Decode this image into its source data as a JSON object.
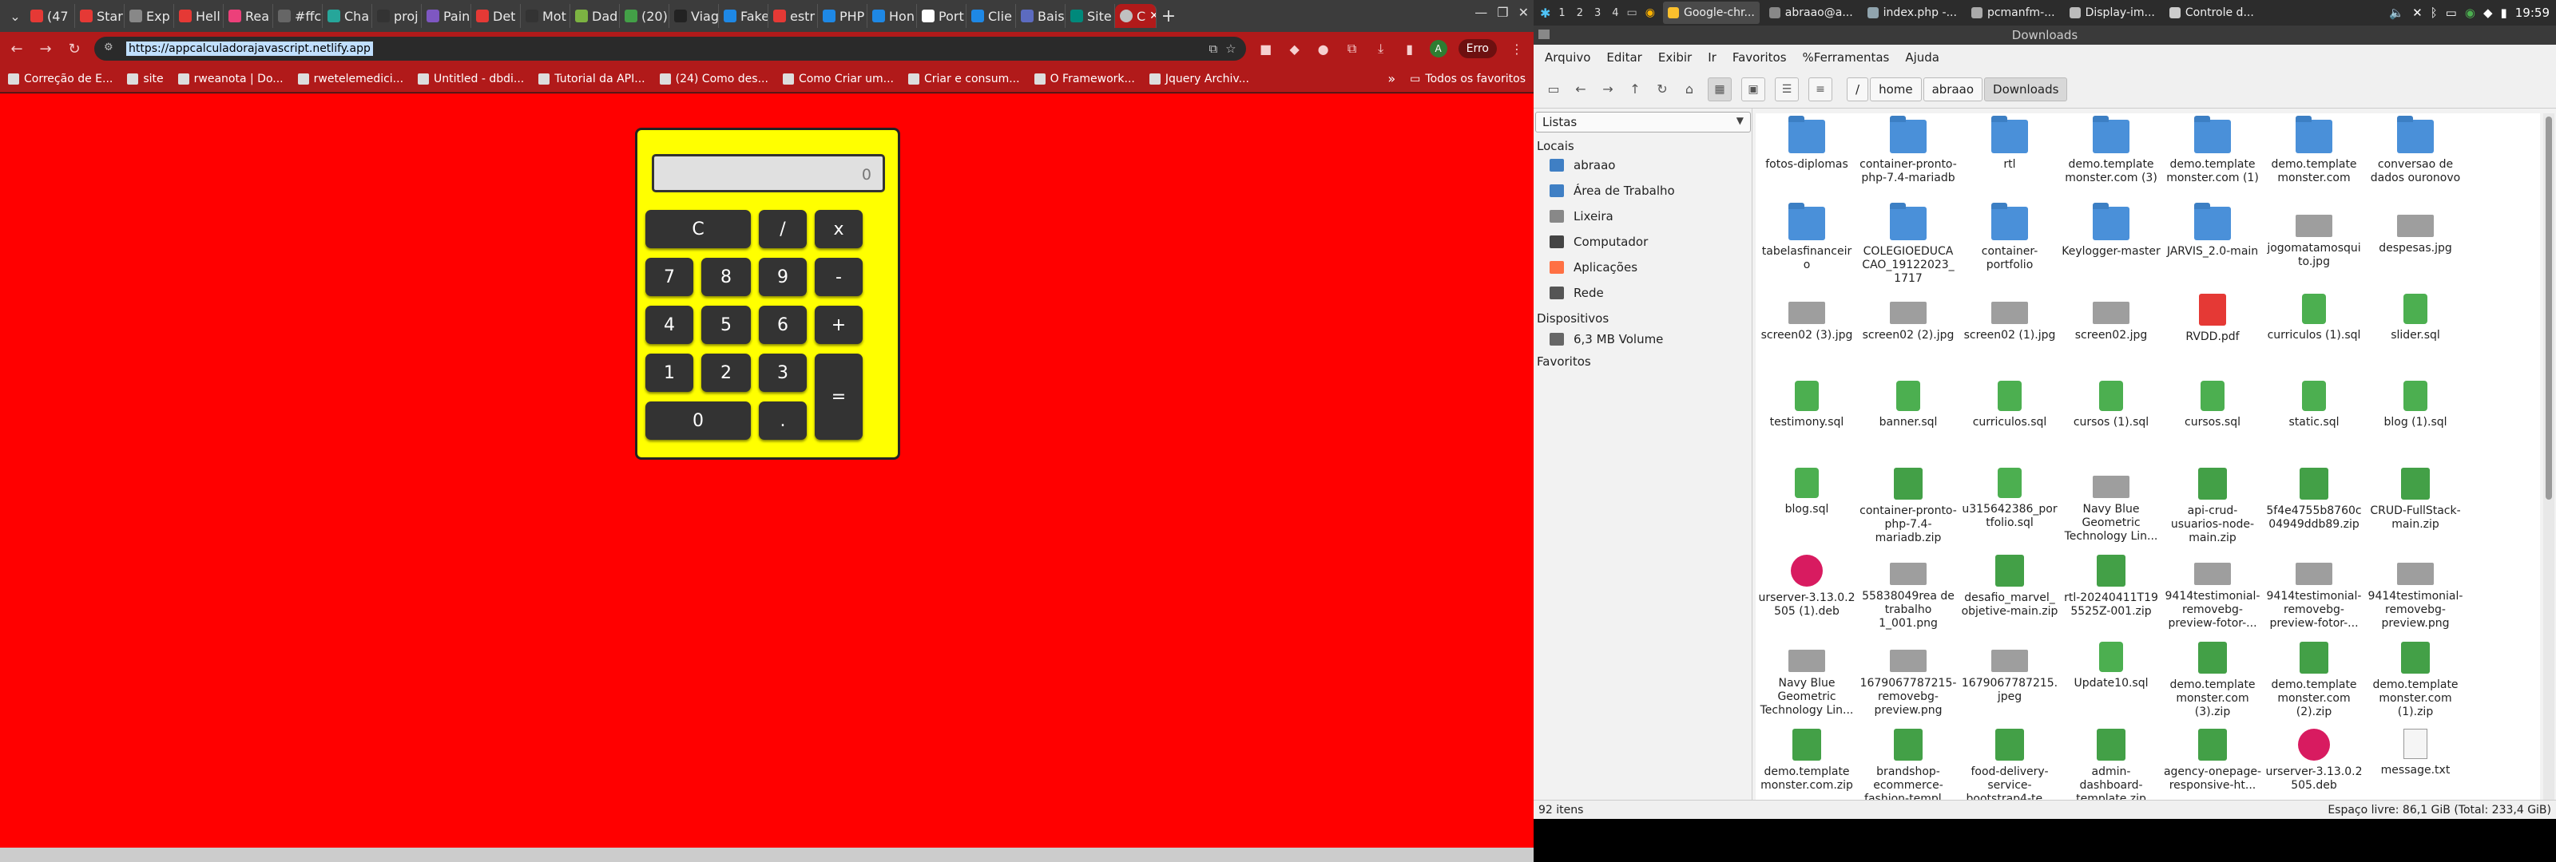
{
  "browser": {
    "tabs": [
      {
        "label": "(47",
        "color": "#e53935"
      },
      {
        "label": "Star",
        "color": "#e53935"
      },
      {
        "label": "Exp",
        "color": "#888"
      },
      {
        "label": "Hell",
        "color": "#e53935"
      },
      {
        "label": "Rea",
        "color": "#ec407a"
      },
      {
        "label": "#ffc",
        "color": "#666"
      },
      {
        "label": "Cha",
        "color": "#26a69a"
      },
      {
        "label": "proj",
        "color": "#333"
      },
      {
        "label": "Pain",
        "color": "#7e57c2"
      },
      {
        "label": "Det",
        "color": "#e53935"
      },
      {
        "label": "Mot",
        "color": "#333"
      },
      {
        "label": "Dad",
        "color": "#7cb342"
      },
      {
        "label": "(20)",
        "color": "#43a047"
      },
      {
        "label": "Viag",
        "color": "#222"
      },
      {
        "label": "Fake",
        "color": "#1e88e5"
      },
      {
        "label": "estr",
        "color": "#e53935"
      },
      {
        "label": "PHP",
        "color": "#1e88e5"
      },
      {
        "label": "Hon",
        "color": "#1e88e5"
      },
      {
        "label": "Port",
        "color": "#fff"
      },
      {
        "label": "Clie",
        "color": "#1e88e5"
      },
      {
        "label": "Bais",
        "color": "#5c6bc0"
      },
      {
        "label": "Site",
        "color": "#00897b"
      }
    ],
    "active_tab_label": "C",
    "url": "https://appcalculadorajavascript.netlify.app",
    "profile_initial": "A",
    "error_label": "Erro",
    "bookmarks": [
      "Correção de E...",
      "site",
      "rweanota | Do...",
      "rwetelemedici...",
      "Untitled - dbdi...",
      "Tutorial da API...",
      "(24) Como des...",
      "Como Criar um...",
      "Criar e consum...",
      "O Framework...",
      "Jquery Archiv..."
    ],
    "bookmarks_more": "»",
    "all_bookmarks": "Todos os favoritos"
  },
  "calculator": {
    "display_value": "0",
    "buttons": {
      "clear": "C",
      "divide": "/",
      "multiply": "x",
      "n7": "7",
      "n8": "8",
      "n9": "9",
      "minus": "-",
      "n4": "4",
      "n5": "5",
      "n6": "6",
      "plus": "+",
      "n1": "1",
      "n2": "2",
      "n3": "3",
      "equals": "=",
      "n0": "0",
      "dot": "."
    }
  },
  "panel": {
    "workspaces": [
      "1",
      "2",
      "3",
      "4"
    ],
    "tasks": [
      "Google-chr...",
      "abraao@a...",
      "index.php -...",
      "pcmanfm-...",
      "Display-im...",
      "Controle d..."
    ],
    "clock": "19:59"
  },
  "filemanager": {
    "title": "Downloads",
    "menu": [
      "Arquivo",
      "Editar",
      "Exibir",
      "Ir",
      "Favoritos",
      "%Ferramentas",
      "Ajuda"
    ],
    "path": [
      "/",
      "home",
      "abraao",
      "Downloads"
    ],
    "side_mode": "Listas",
    "places_header": "Locais",
    "places": [
      "abraao",
      "Área de Trabalho",
      "Lixeira",
      "Computador",
      "Aplicações",
      "Rede"
    ],
    "devices_header": "Dispositivos",
    "devices": [
      "6,3 MB Volume"
    ],
    "favorites_header": "Favoritos",
    "files": [
      {
        "name": "fotos-diplomas",
        "type": "folder"
      },
      {
        "name": "container-pronto-php-7.4-mariadb",
        "type": "folder"
      },
      {
        "name": "rtl",
        "type": "folder"
      },
      {
        "name": "demo.template monster.com (3)",
        "type": "folder"
      },
      {
        "name": "demo.template monster.com (1)",
        "type": "folder"
      },
      {
        "name": "demo.template monster.com",
        "type": "folder"
      },
      {
        "name": "conversao de dados ouronovo",
        "type": "folder"
      },
      {
        "name": "tabelasfinanceir o",
        "type": "folder"
      },
      {
        "name": "COLEGIOEDUCA CAO_19122023_ 1717",
        "type": "folder"
      },
      {
        "name": "container-portfolio",
        "type": "folder"
      },
      {
        "name": "Keylogger-master",
        "type": "folder"
      },
      {
        "name": "JARVIS_2.0-main",
        "type": "folder"
      },
      {
        "name": "jogomatamosqui to.jpg",
        "type": "img"
      },
      {
        "name": "despesas.jpg",
        "type": "img"
      },
      {
        "name": "screen02 (3).jpg",
        "type": "img"
      },
      {
        "name": "screen02 (2).jpg",
        "type": "img"
      },
      {
        "name": "screen02 (1).jpg",
        "type": "img"
      },
      {
        "name": "screen02.jpg",
        "type": "img"
      },
      {
        "name": "RVDD.pdf",
        "type": "pdf"
      },
      {
        "name": "curriculos (1).sql",
        "type": "sql"
      },
      {
        "name": "slider.sql",
        "type": "sql"
      },
      {
        "name": "testimony.sql",
        "type": "sql"
      },
      {
        "name": "banner.sql",
        "type": "sql"
      },
      {
        "name": "curriculos.sql",
        "type": "sql"
      },
      {
        "name": "cursos (1).sql",
        "type": "sql"
      },
      {
        "name": "cursos.sql",
        "type": "sql"
      },
      {
        "name": "static.sql",
        "type": "sql"
      },
      {
        "name": "blog (1).sql",
        "type": "sql"
      },
      {
        "name": "blog.sql",
        "type": "sql"
      },
      {
        "name": "container-pronto-php-7.4-mariadb.zip",
        "type": "zip"
      },
      {
        "name": "u315642386_por tfolio.sql",
        "type": "sql"
      },
      {
        "name": "Navy Blue Geometric Technology Lin...",
        "type": "img"
      },
      {
        "name": "api-crud-usuarios-node-main.zip",
        "type": "zip"
      },
      {
        "name": "5f4e4755b8760c 04949ddb89.zip",
        "type": "zip"
      },
      {
        "name": "CRUD-FullStack-main.zip",
        "type": "zip"
      },
      {
        "name": "urserver-3.13.0.2 505 (1).deb",
        "type": "deb"
      },
      {
        "name": "55838049rea de trabalho 1_001.png",
        "type": "img"
      },
      {
        "name": "desafio_marvel_ objetive-main.zip",
        "type": "zip"
      },
      {
        "name": "rtl-20240411T19 5525Z-001.zip",
        "type": "zip"
      },
      {
        "name": "9414testimonial-removebg-preview-fotor-...",
        "type": "img"
      },
      {
        "name": "9414testimonial-removebg-preview-fotor-...",
        "type": "img"
      },
      {
        "name": "9414testimonial-removebg-preview.png",
        "type": "img"
      },
      {
        "name": "Navy Blue Geometric Technology Lin...",
        "type": "img"
      },
      {
        "name": "1679067787215-removebg-preview.png",
        "type": "img"
      },
      {
        "name": "1679067787215. jpeg",
        "type": "img"
      },
      {
        "name": "Update10.sql",
        "type": "sql"
      },
      {
        "name": "demo.template monster.com (3).zip",
        "type": "zip"
      },
      {
        "name": "demo.template monster.com (2).zip",
        "type": "zip"
      },
      {
        "name": "demo.template monster.com (1).zip",
        "type": "zip"
      },
      {
        "name": "demo.template monster.com.zip",
        "type": "zip"
      },
      {
        "name": "brandshop-ecommerce-fashion-templ...",
        "type": "zip"
      },
      {
        "name": "food-delivery-service-bootstrap4-te...",
        "type": "zip"
      },
      {
        "name": "admin-dashboard-template.zip",
        "type": "zip"
      },
      {
        "name": "agency-onepage-responsive-ht...",
        "type": "zip"
      },
      {
        "name": "urserver-3.13.0.2 505.deb",
        "type": "deb"
      },
      {
        "name": "message.txt",
        "type": "txt"
      }
    ],
    "status_count": "92 itens",
    "status_free": "Espaço livre: 86,1 GiB (Total: 233,4 GiB)"
  }
}
